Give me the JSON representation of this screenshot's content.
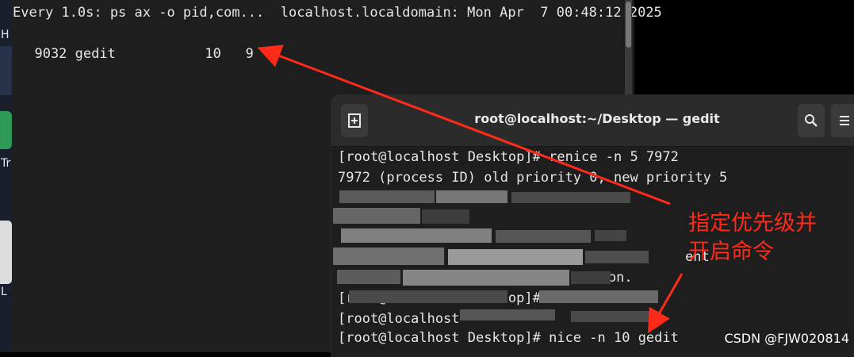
{
  "watch_terminal": {
    "header": "Every 1.0s: ps ax -o pid,com...  localhost.localdomain: Mon Apr  7 00:48:12 2025",
    "process_row": "  9032 gedit           10   9"
  },
  "gedit_terminal": {
    "title": "root@localhost:~/Desktop — gedit",
    "new_tab_icon": "new-tab-icon",
    "search_icon": "search-icon",
    "menu_icon": "hamburger-menu-icon",
    "lines": [
      "[root@localhost Desktop]# renice -n 5 7972",
      "7972 (process ID) old priority 0, new priority 5",
      "[root@localhost Desktop]# nice -n 10 gedit"
    ],
    "partial_lines": [
      "[root@localhost Desktop]#",
      "[root@localhost"
    ],
    "fragments": [
      "ent",
      "mation."
    ]
  },
  "desktop": {
    "letters": [
      "H",
      "Tr",
      "L"
    ]
  },
  "annotation": {
    "text_line1": "指定优先级并",
    "text_line2": "开启命令",
    "color": "#ff2a1a"
  },
  "watermark": "CSDN @FJW020814"
}
